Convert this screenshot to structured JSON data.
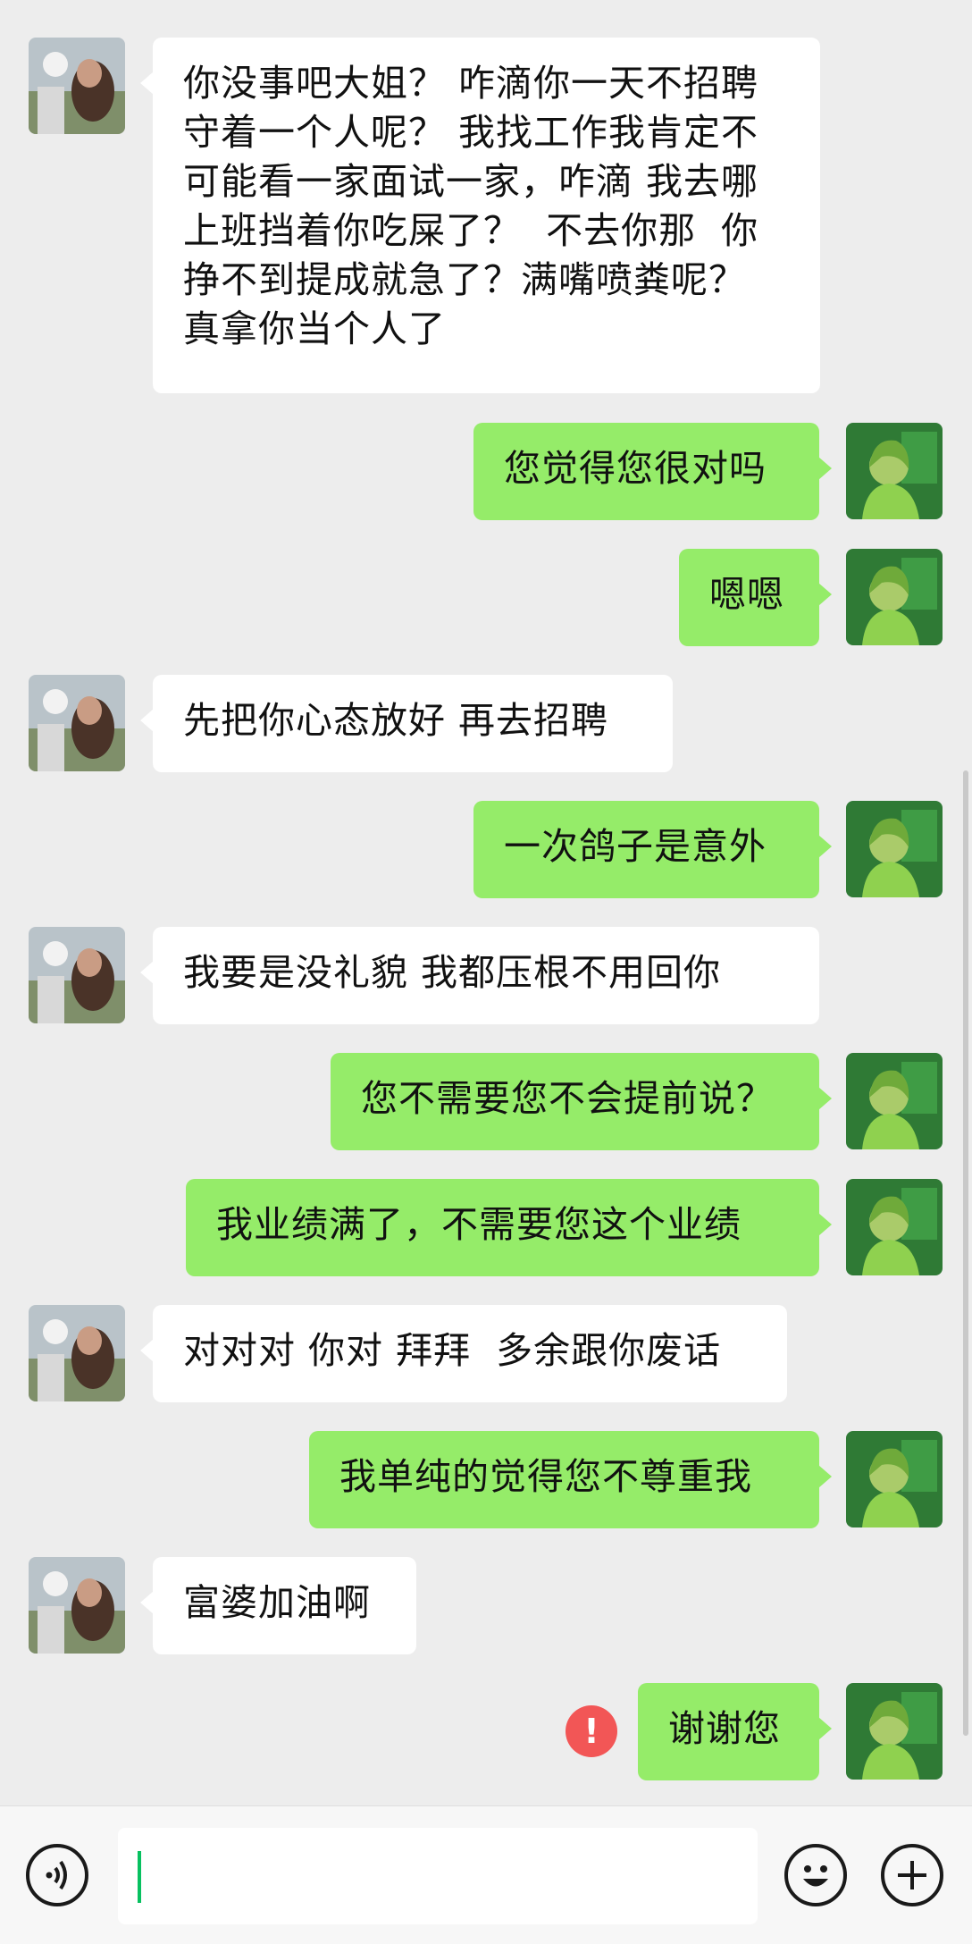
{
  "messages": [
    {
      "side": "in",
      "text": "你没事吧大姐？ 咋滴你一天不招聘\n守着一个人呢？ 我找工作我肯定不\n可能看一家面试一家，咋滴 我去哪\n上班挡着你吃屎了？  不去你那  你\n挣不到提成就急了？满嘴喷粪呢？\n真拿你当个人了"
    },
    {
      "side": "out",
      "text": "您觉得您很对吗"
    },
    {
      "side": "out",
      "text": "嗯嗯"
    },
    {
      "side": "in",
      "text": "先把你心态放好 再去招聘"
    },
    {
      "side": "out",
      "text": "一次鸽子是意外"
    },
    {
      "side": "in",
      "text": "我要是没礼貌 我都压根不用回你"
    },
    {
      "side": "out",
      "text": "您不需要您不会提前说？"
    },
    {
      "side": "out",
      "text": "我业绩满了，不需要您这个业绩"
    },
    {
      "side": "in",
      "text": "对对对 你对 拜拜  多余跟你废话"
    },
    {
      "side": "out",
      "text": "我单纯的觉得您不尊重我"
    },
    {
      "side": "in",
      "text": "富婆加油啊"
    },
    {
      "side": "out",
      "text": "谢谢您",
      "error": "!"
    }
  ],
  "input": {
    "value": ""
  },
  "icons": {
    "voice": "voice-icon",
    "emoji": "emoji-icon",
    "more": "plus-icon"
  },
  "colors": {
    "out_bubble": "#95ec69",
    "in_bubble": "#ffffff",
    "background": "#ededed",
    "error": "#f25656"
  }
}
